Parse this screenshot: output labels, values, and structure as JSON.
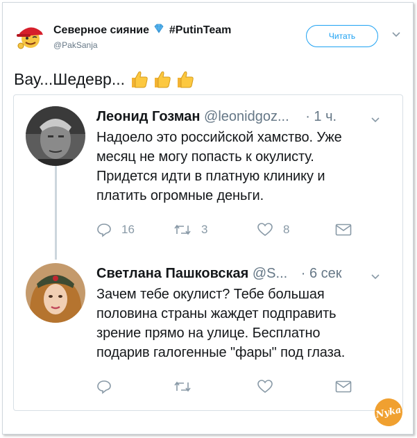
{
  "tweet": {
    "author_name": "Северное сияние",
    "hashtag": "#PutinTeam",
    "handle": "@PakSanja",
    "follow_label": "Читать",
    "text": "Вау...Шедевр..."
  },
  "thread": [
    {
      "name": "Леонид Гозман",
      "handle": "@leonidgoz...",
      "time": "· 1 ч.",
      "lines": [
        "Надоело это российской хамство. Уже",
        "месяц не могу попасть к окулисту.",
        "Придется идти в платную клинику и",
        "платить огромные деньги."
      ],
      "replies": "16",
      "retweets": "3",
      "likes": "8"
    },
    {
      "name": "Светлана Пашковская",
      "handle": "@S...",
      "time": "· 6 сек",
      "lines": [
        "Зачем тебе окулист? Тебе большая",
        "половина страны жаждет подправить",
        "зрение прямо на улице. Бесплатно",
        "подарив галогенные \"фары\" под глаза."
      ]
    }
  ],
  "colors": {
    "accent": "#1da1f2",
    "text": "#14171a",
    "muted": "#657786",
    "icon": "#8899a6"
  }
}
